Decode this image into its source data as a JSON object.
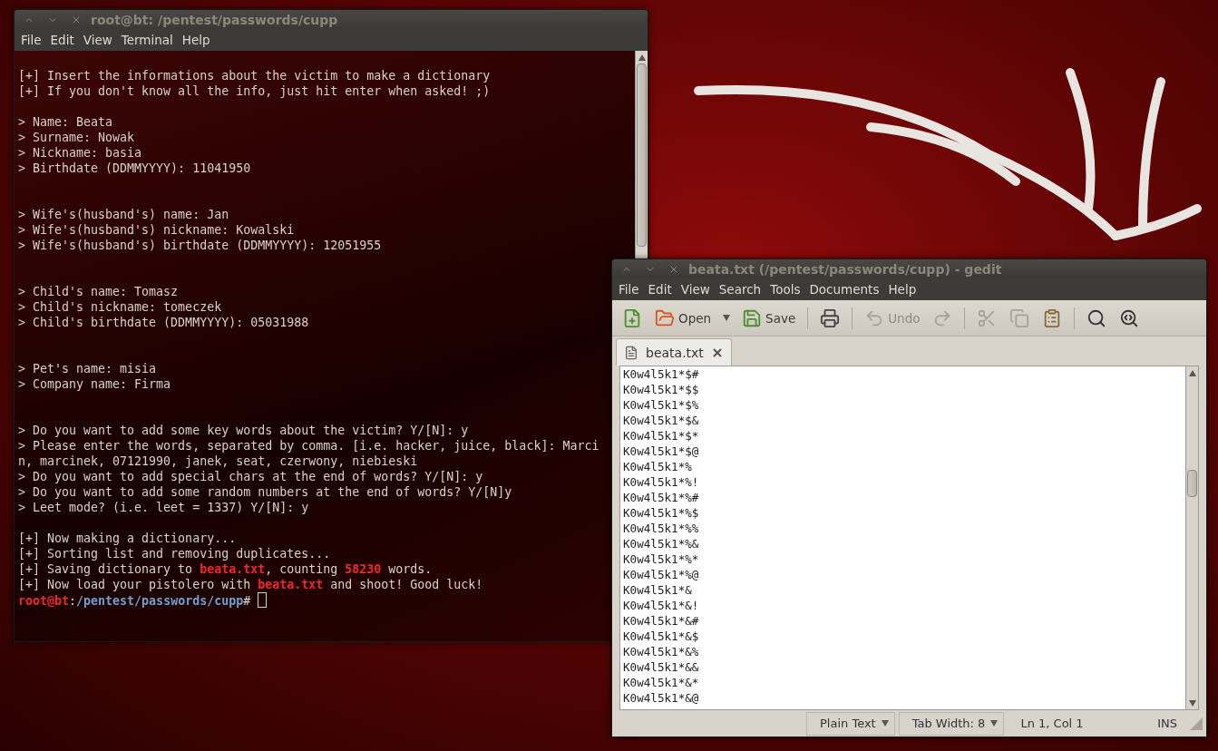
{
  "terminal": {
    "title": "root@bt: /pentest/passwords/cupp",
    "menu": [
      "File",
      "Edit",
      "View",
      "Terminal",
      "Help"
    ],
    "lines": [
      {
        "kind": "text",
        "text": "[+] Insert the informations about the victim to make a dictionary"
      },
      {
        "kind": "text",
        "text": "[+] If you don't know all the info, just hit enter when asked! ;)"
      },
      {
        "kind": "blank"
      },
      {
        "kind": "text",
        "text": "> Name: Beata"
      },
      {
        "kind": "text",
        "text": "> Surname: Nowak"
      },
      {
        "kind": "text",
        "text": "> Nickname: basia"
      },
      {
        "kind": "text",
        "text": "> Birthdate (DDMMYYYY): 11041950"
      },
      {
        "kind": "blank"
      },
      {
        "kind": "blank"
      },
      {
        "kind": "text",
        "text": "> Wife's(husband's) name: Jan"
      },
      {
        "kind": "text",
        "text": "> Wife's(husband's) nickname: Kowalski"
      },
      {
        "kind": "text",
        "text": "> Wife's(husband's) birthdate (DDMMYYYY): 12051955"
      },
      {
        "kind": "blank"
      },
      {
        "kind": "blank"
      },
      {
        "kind": "text",
        "text": "> Child's name: Tomasz"
      },
      {
        "kind": "text",
        "text": "> Child's nickname: tomeczek"
      },
      {
        "kind": "text",
        "text": "> Child's birthdate (DDMMYYYY): 05031988"
      },
      {
        "kind": "blank"
      },
      {
        "kind": "blank"
      },
      {
        "kind": "text",
        "text": "> Pet's name: misia"
      },
      {
        "kind": "text",
        "text": "> Company name: Firma"
      },
      {
        "kind": "blank"
      },
      {
        "kind": "blank"
      },
      {
        "kind": "text",
        "text": "> Do you want to add some key words about the victim? Y/[N]: y"
      },
      {
        "kind": "text",
        "text": "> Please enter the words, separated by comma. [i.e. hacker, juice, black]: Marci"
      },
      {
        "kind": "text",
        "text": "n, marcinek, 07121990, janek, seat, czerwony, niebieski"
      },
      {
        "kind": "text",
        "text": "> Do you want to add special chars at the end of words? Y/[N]: y"
      },
      {
        "kind": "text",
        "text": "> Do you want to add some random numbers at the end of words? Y/[N]y"
      },
      {
        "kind": "text",
        "text": "> Leet mode? (i.e. leet = 1337) Y/[N]: y"
      },
      {
        "kind": "blank"
      },
      {
        "kind": "text",
        "text": "[+] Now making a dictionary..."
      },
      {
        "kind": "text",
        "text": "[+] Sorting list and removing duplicates..."
      },
      {
        "kind": "segments",
        "segments": [
          {
            "kind": "plain",
            "text": "[+] Saving dictionary to "
          },
          {
            "kind": "alert",
            "text": "beata.txt"
          },
          {
            "kind": "plain",
            "text": ", counting "
          },
          {
            "kind": "alert",
            "text": "58230"
          },
          {
            "kind": "plain",
            "text": " words."
          }
        ]
      },
      {
        "kind": "segments",
        "segments": [
          {
            "kind": "plain",
            "text": "[+] Now load your pistolero with "
          },
          {
            "kind": "alert",
            "text": "beata.txt"
          },
          {
            "kind": "plain",
            "text": " and shoot! Good luck!"
          }
        ]
      },
      {
        "kind": "prompt",
        "cursor": true,
        "segments": [
          {
            "kind": "user",
            "text": "root@bt"
          },
          {
            "kind": "plain",
            "text": ":"
          },
          {
            "kind": "path",
            "text": "/pentest/passwords/cupp"
          },
          {
            "kind": "plain",
            "text": "# "
          }
        ]
      }
    ]
  },
  "gedit": {
    "title": "beata.txt (/pentest/passwords/cupp) - gedit",
    "menu": [
      "File",
      "Edit",
      "View",
      "Search",
      "Tools",
      "Documents",
      "Help"
    ],
    "toolbar": [
      [
        {
          "kind": "new",
          "disabled": false
        },
        {
          "kind": "open",
          "label": "Open",
          "disabled": false
        },
        {
          "kind": "save",
          "label": "Save",
          "disabled": false
        }
      ],
      [
        {
          "kind": "print",
          "disabled": false
        }
      ],
      [
        {
          "kind": "undo",
          "label": "Undo",
          "disabled": true
        },
        {
          "kind": "redo",
          "disabled": true
        }
      ],
      [
        {
          "kind": "cut",
          "disabled": true
        },
        {
          "kind": "copy",
          "disabled": true
        },
        {
          "kind": "paste",
          "disabled": false
        }
      ],
      [
        {
          "kind": "find",
          "disabled": false
        },
        {
          "kind": "replace",
          "disabled": false
        }
      ]
    ],
    "tabs": [
      {
        "label": "beata.txt",
        "selected": true
      }
    ],
    "lines": [
      "K0w4l5k1*$#",
      "K0w4l5k1*$$",
      "K0w4l5k1*$%",
      "K0w4l5k1*$&",
      "K0w4l5k1*$*",
      "K0w4l5k1*$@",
      "K0w4l5k1*%",
      "K0w4l5k1*%!",
      "K0w4l5k1*%#",
      "K0w4l5k1*%$",
      "K0w4l5k1*%%",
      "K0w4l5k1*%&",
      "K0w4l5k1*%*",
      "K0w4l5k1*%@",
      "K0w4l5k1*&",
      "K0w4l5k1*&!",
      "K0w4l5k1*&#",
      "K0w4l5k1*&$",
      "K0w4l5k1*&%",
      "K0w4l5k1*&&",
      "K0w4l5k1*&*",
      "K0w4l5k1*&@"
    ],
    "status_bar": {
      "language": "Plain Text",
      "tab_width": "Tab Width:  8",
      "position": "Ln 1, Col 1",
      "mode": "INS"
    }
  }
}
